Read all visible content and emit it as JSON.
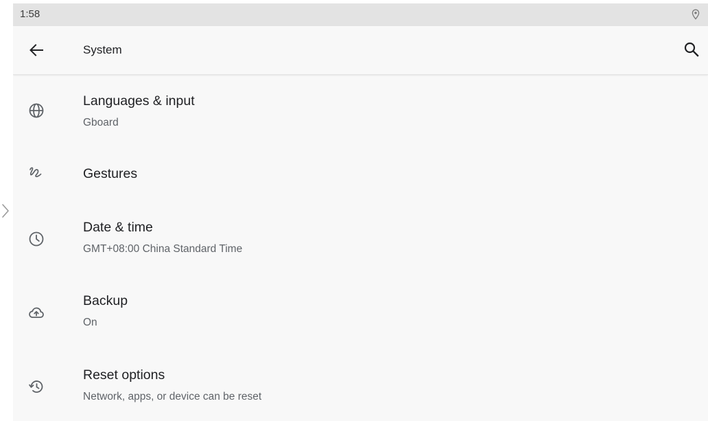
{
  "status_bar": {
    "time": "1:58",
    "location_icon": "location-pin-icon"
  },
  "app_bar": {
    "back_icon": "arrow-back-icon",
    "title": "System",
    "search_icon": "search-icon"
  },
  "items": [
    {
      "icon": "globe-icon",
      "title": "Languages & input",
      "subtitle": "Gboard"
    },
    {
      "icon": "gesture-icon",
      "title": "Gestures",
      "subtitle": ""
    },
    {
      "icon": "clock-icon",
      "title": "Date & time",
      "subtitle": "GMT+08:00 China Standard Time"
    },
    {
      "icon": "cloud-upload-icon",
      "title": "Backup",
      "subtitle": "On"
    },
    {
      "icon": "restore-icon",
      "title": "Reset options",
      "subtitle": "Network, apps, or device can be reset"
    }
  ],
  "colors": {
    "background": "#f8f8f8",
    "status_bar": "#e3e3e3",
    "primary_text": "#202124",
    "secondary_text": "#5f6368",
    "icon": "#5f6368"
  }
}
